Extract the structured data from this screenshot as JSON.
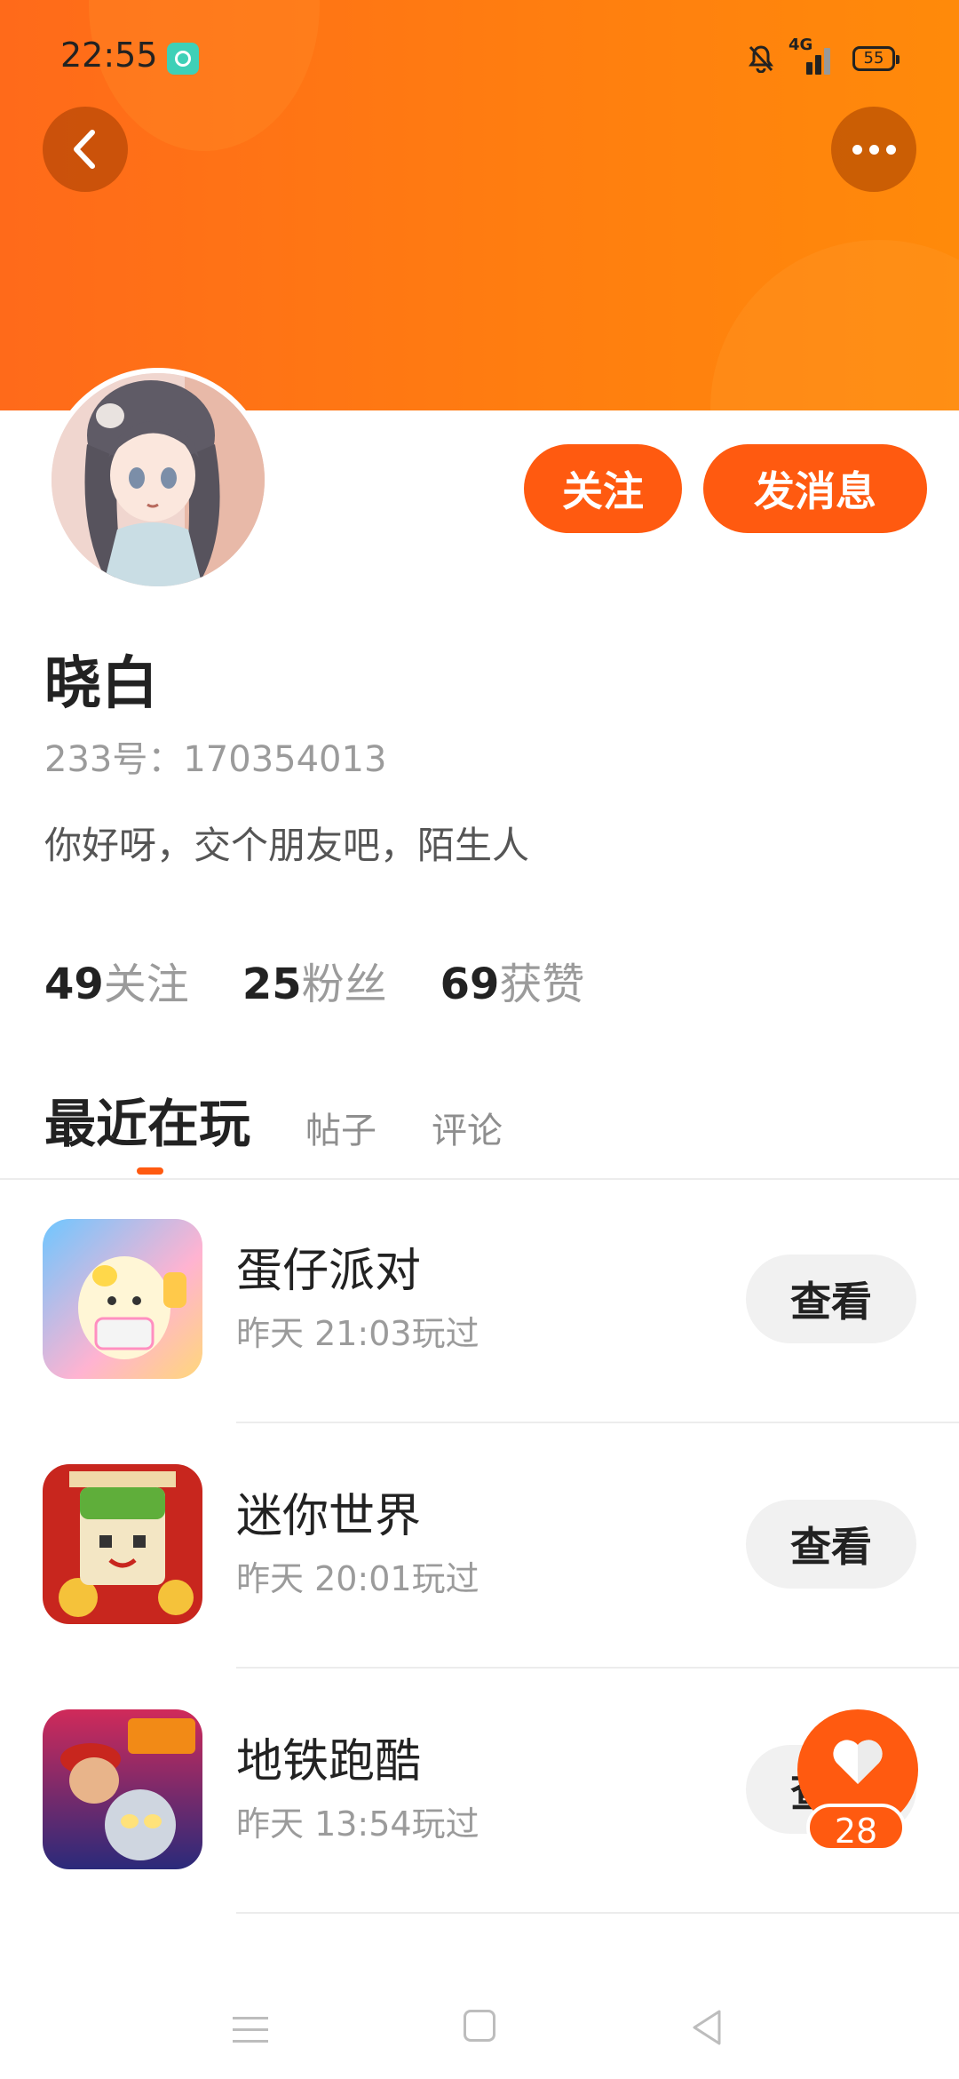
{
  "status_bar": {
    "time": "22:55",
    "network": "4G",
    "battery": "55"
  },
  "profile": {
    "name": "晓白",
    "uid": "233号：170354013",
    "bio": "你好呀，交个朋友吧，陌生人",
    "follow_label": "关注",
    "message_label": "发消息"
  },
  "stats": [
    {
      "num": "49",
      "label": "关注"
    },
    {
      "num": "25",
      "label": "粉丝"
    },
    {
      "num": "69",
      "label": "获赞"
    }
  ],
  "tabs": {
    "active": "最近在玩",
    "posts": "帖子",
    "comments": "评论"
  },
  "games": [
    {
      "title": "蛋仔派对",
      "played": "昨天 21:03玩过",
      "button": "查看"
    },
    {
      "title": "迷你世界",
      "played": "昨天 20:01玩过",
      "button": "查看"
    },
    {
      "title": "地铁跑酷",
      "played": "昨天 13:54玩过",
      "button": "查看"
    }
  ],
  "like_count": "28",
  "colors": {
    "accent": "#ff5a10",
    "header": "#ff7d10"
  }
}
